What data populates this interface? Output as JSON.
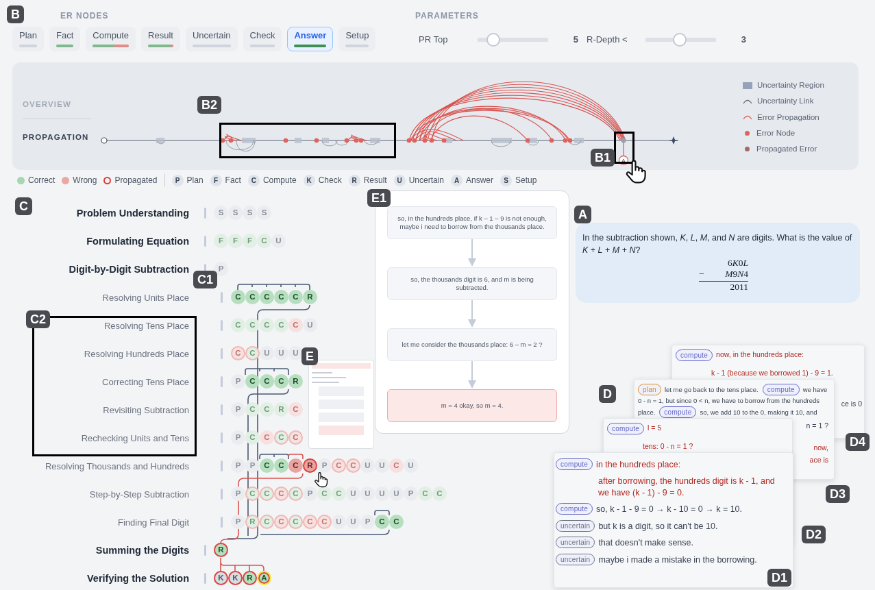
{
  "callouts": [
    "B",
    "B2",
    "B1",
    "C",
    "C1",
    "C2",
    "E",
    "E1",
    "A",
    "D",
    "D1",
    "D2",
    "D3",
    "D4"
  ],
  "filter": {
    "title": "ER NODES",
    "chips": [
      {
        "label": "Plan",
        "selected": false
      },
      {
        "label": "Fact",
        "selected": false,
        "bar": [
          {
            "kind": "correct",
            "level": 1
          }
        ]
      },
      {
        "label": "Compute",
        "selected": false,
        "bar": [
          {
            "kind": "correct",
            "level": 0.6
          },
          {
            "kind": "wrong",
            "level": 0.4
          }
        ]
      },
      {
        "label": "Result",
        "selected": false,
        "bar": [
          {
            "kind": "correct",
            "level": 0.88
          },
          {
            "kind": "wrong",
            "level": 0.12
          }
        ]
      },
      {
        "label": "Uncertain",
        "selected": false
      },
      {
        "label": "Check",
        "selected": false
      },
      {
        "label": "Answer",
        "selected": true,
        "bar": [
          {
            "kind": "correct",
            "level": 1
          }
        ]
      },
      {
        "label": "Setup",
        "selected": false
      }
    ]
  },
  "parameters": {
    "title": "PARAMETERS",
    "sliders": [
      {
        "label": "PR Top",
        "level": 0.22,
        "value": "5"
      },
      {
        "label": "R-Depth <",
        "level": 0.49,
        "value": "3"
      }
    ]
  },
  "overview": {
    "tabs": [
      {
        "label": "OVERVIEW",
        "selected": false
      },
      {
        "label": "PROPAGATION",
        "selected": true
      }
    ],
    "answer_marker": "A",
    "legend": [
      {
        "kind": "region",
        "label": "Uncertainty Region"
      },
      {
        "kind": "uncertain-link",
        "label": "Uncertainty Link"
      },
      {
        "kind": "error-link",
        "label": "Error Propagation"
      },
      {
        "kind": "error-node",
        "label": "Error Node"
      },
      {
        "kind": "propagated-node",
        "label": "Propagated Error"
      }
    ]
  },
  "legend": {
    "statuses": [
      {
        "kind": "correct",
        "label": "Correct"
      },
      {
        "kind": "wrong",
        "label": "Wrong"
      },
      {
        "kind": "propagated",
        "label": "Propagated"
      }
    ],
    "types": [
      {
        "letter": "P",
        "label": "Plan"
      },
      {
        "letter": "F",
        "label": "Fact"
      },
      {
        "letter": "C",
        "label": "Compute"
      },
      {
        "letter": "K",
        "label": "Check"
      },
      {
        "letter": "R",
        "label": "Result"
      },
      {
        "letter": "U",
        "label": "Uncertain"
      },
      {
        "letter": "A",
        "label": "Answer"
      },
      {
        "letter": "S",
        "label": "Setup"
      }
    ]
  },
  "tree": [
    {
      "label": "Problem Understanding",
      "kind": "phase",
      "nodes": [
        {
          "letter": "S",
          "kind": "neutral",
          "active": false,
          "propagated": false
        },
        {
          "letter": "S",
          "kind": "neutral",
          "active": false,
          "propagated": false
        },
        {
          "letter": "S",
          "kind": "neutral",
          "active": false,
          "propagated": false
        },
        {
          "letter": "S",
          "kind": "neutral",
          "active": false,
          "propagated": false
        }
      ]
    },
    {
      "label": "Formulating Equation",
      "kind": "phase",
      "nodes": [
        {
          "letter": "F",
          "kind": "correct",
          "active": false,
          "propagated": false
        },
        {
          "letter": "F",
          "kind": "correct",
          "active": false,
          "propagated": false
        },
        {
          "letter": "F",
          "kind": "correct",
          "active": false,
          "propagated": false
        },
        {
          "letter": "C",
          "kind": "correct",
          "active": false,
          "propagated": false
        },
        {
          "letter": "U",
          "kind": "neutral",
          "active": false,
          "propagated": false
        }
      ]
    },
    {
      "label": "Digit-by-Digit Subtraction",
      "kind": "phase",
      "nodes": [
        {
          "letter": "P",
          "kind": "neutral",
          "active": false,
          "propagated": false
        }
      ]
    },
    {
      "label": "Resolving Units Place",
      "kind": "step",
      "nodes": [
        {
          "letter": "C",
          "kind": "correct",
          "active": true,
          "propagated": false
        },
        {
          "letter": "C",
          "kind": "correct",
          "active": true,
          "propagated": false
        },
        {
          "letter": "C",
          "kind": "correct",
          "active": true,
          "propagated": false
        },
        {
          "letter": "C",
          "kind": "correct",
          "active": true,
          "propagated": false
        },
        {
          "letter": "C",
          "kind": "correct",
          "active": true,
          "propagated": false
        },
        {
          "letter": "R",
          "kind": "correct",
          "active": true,
          "propagated": false
        }
      ]
    },
    {
      "label": "Resolving Tens Place",
      "kind": "step",
      "nodes": [
        {
          "letter": "C",
          "kind": "correct",
          "active": false,
          "propagated": false
        },
        {
          "letter": "C",
          "kind": "correct",
          "active": false,
          "propagated": false
        },
        {
          "letter": "C",
          "kind": "correct",
          "active": false,
          "propagated": false
        },
        {
          "letter": "C",
          "kind": "correct",
          "active": false,
          "propagated": false
        },
        {
          "letter": "C",
          "kind": "wrong",
          "active": false,
          "propagated": false
        },
        {
          "letter": "U",
          "kind": "neutral",
          "active": false,
          "propagated": false
        }
      ]
    },
    {
      "label": "Resolving Hundreds Place",
      "kind": "step",
      "nodes": [
        {
          "letter": "C",
          "kind": "wrong",
          "active": false,
          "propagated": true
        },
        {
          "letter": "C",
          "kind": "correct",
          "active": false,
          "propagated": true
        },
        {
          "letter": "U",
          "kind": "neutral",
          "active": false,
          "propagated": false
        },
        {
          "letter": "U",
          "kind": "neutral",
          "active": false,
          "propagated": false
        },
        {
          "letter": "U",
          "kind": "neutral",
          "active": false,
          "propagated": false
        }
      ]
    },
    {
      "label": "Correcting Tens Place",
      "kind": "step",
      "nodes": [
        {
          "letter": "P",
          "kind": "neutral",
          "active": false,
          "propagated": false
        },
        {
          "letter": "C",
          "kind": "correct",
          "active": true,
          "propagated": false
        },
        {
          "letter": "C",
          "kind": "correct",
          "active": true,
          "propagated": false
        },
        {
          "letter": "C",
          "kind": "correct",
          "active": true,
          "propagated": false
        },
        {
          "letter": "R",
          "kind": "correct",
          "active": true,
          "propagated": false
        }
      ]
    },
    {
      "label": "Revisiting Subtraction",
      "kind": "step",
      "nodes": [
        {
          "letter": "P",
          "kind": "neutral",
          "active": false,
          "propagated": false
        },
        {
          "letter": "C",
          "kind": "correct",
          "active": false,
          "propagated": false
        },
        {
          "letter": "C",
          "kind": "correct",
          "active": false,
          "propagated": false
        },
        {
          "letter": "R",
          "kind": "correct",
          "active": false,
          "propagated": false
        },
        {
          "letter": "C",
          "kind": "wrong",
          "active": false,
          "propagated": false
        }
      ]
    },
    {
      "label": "Rechecking Units and Tens",
      "kind": "step",
      "nodes": [
        {
          "letter": "P",
          "kind": "neutral",
          "active": false,
          "propagated": false
        },
        {
          "letter": "C",
          "kind": "correct",
          "active": false,
          "propagated": false
        },
        {
          "letter": "C",
          "kind": "wrong",
          "active": false,
          "propagated": false
        },
        {
          "letter": "C",
          "kind": "correct",
          "active": false,
          "propagated": true
        },
        {
          "letter": "C",
          "kind": "wrong",
          "active": false,
          "propagated": true
        }
      ]
    },
    {
      "label": "Resolving Thousands and Hundreds",
      "kind": "step",
      "nodes": [
        {
          "letter": "P",
          "kind": "neutral",
          "active": false,
          "propagated": false
        },
        {
          "letter": "P",
          "kind": "neutral",
          "active": false,
          "propagated": false
        },
        {
          "letter": "C",
          "kind": "correct",
          "active": true,
          "propagated": false
        },
        {
          "letter": "C",
          "kind": "correct",
          "active": true,
          "propagated": false
        },
        {
          "letter": "C",
          "kind": "wrong",
          "active": true,
          "propagated": false
        },
        {
          "letter": "R",
          "kind": "wrong",
          "active": true,
          "propagated": true
        },
        {
          "letter": "P",
          "kind": "neutral",
          "active": false,
          "propagated": false
        },
        {
          "letter": "C",
          "kind": "wrong",
          "active": false,
          "propagated": true
        },
        {
          "letter": "C",
          "kind": "wrong",
          "active": false,
          "propagated": true
        },
        {
          "letter": "U",
          "kind": "neutral",
          "active": false,
          "propagated": false
        },
        {
          "letter": "U",
          "kind": "neutral",
          "active": false,
          "propagated": false
        },
        {
          "letter": "C",
          "kind": "wrong",
          "active": false,
          "propagated": false
        },
        {
          "letter": "U",
          "kind": "neutral",
          "active": false,
          "propagated": false
        }
      ]
    },
    {
      "label": "Step-by-Step Subtraction",
      "kind": "step",
      "nodes": [
        {
          "letter": "P",
          "kind": "neutral",
          "active": false,
          "propagated": false
        },
        {
          "letter": "C",
          "kind": "correct",
          "active": false,
          "propagated": true
        },
        {
          "letter": "C",
          "kind": "correct",
          "active": false,
          "propagated": true
        },
        {
          "letter": "C",
          "kind": "wrong",
          "active": false,
          "propagated": true
        },
        {
          "letter": "C",
          "kind": "correct",
          "active": false,
          "propagated": true
        },
        {
          "letter": "P",
          "kind": "neutral",
          "active": false,
          "propagated": false
        },
        {
          "letter": "C",
          "kind": "correct",
          "active": false,
          "propagated": false
        },
        {
          "letter": "C",
          "kind": "correct",
          "active": false,
          "propagated": false
        },
        {
          "letter": "U",
          "kind": "neutral",
          "active": false,
          "propagated": false
        },
        {
          "letter": "U",
          "kind": "neutral",
          "active": false,
          "propagated": false
        },
        {
          "letter": "U",
          "kind": "neutral",
          "active": false,
          "propagated": false
        },
        {
          "letter": "U",
          "kind": "neutral",
          "active": false,
          "propagated": false
        },
        {
          "letter": "P",
          "kind": "neutral",
          "active": false,
          "propagated": false
        },
        {
          "letter": "C",
          "kind": "correct",
          "active": false,
          "propagated": false
        },
        {
          "letter": "C",
          "kind": "correct",
          "active": false,
          "propagated": false
        }
      ]
    },
    {
      "label": "Finding Final Digit",
      "kind": "step",
      "nodes": [
        {
          "letter": "P",
          "kind": "neutral",
          "active": false,
          "propagated": false
        },
        {
          "letter": "R",
          "kind": "correct",
          "active": false,
          "propagated": true
        },
        {
          "letter": "C",
          "kind": "correct",
          "active": false,
          "propagated": true
        },
        {
          "letter": "C",
          "kind": "wrong",
          "active": false,
          "propagated": true
        },
        {
          "letter": "C",
          "kind": "correct",
          "active": false,
          "propagated": true
        },
        {
          "letter": "C",
          "kind": "wrong",
          "active": false,
          "propagated": true
        },
        {
          "letter": "C",
          "kind": "wrong",
          "active": false,
          "propagated": true
        },
        {
          "letter": "U",
          "kind": "neutral",
          "active": false,
          "propagated": false
        },
        {
          "letter": "U",
          "kind": "neutral",
          "active": false,
          "propagated": false
        },
        {
          "letter": "P",
          "kind": "neutral",
          "active": false,
          "propagated": false
        },
        {
          "letter": "C",
          "kind": "correct",
          "active": true,
          "propagated": false
        },
        {
          "letter": "C",
          "kind": "correct",
          "active": true,
          "propagated": false
        }
      ]
    },
    {
      "label": "Summing the Digits",
      "kind": "phase",
      "nodes": [
        {
          "letter": "R",
          "kind": "correct",
          "active": true,
          "propagated": true
        }
      ]
    },
    {
      "label": "Verifying the Solution",
      "kind": "phase",
      "nodes": [
        {
          "letter": "K",
          "kind": "neutral",
          "active": true,
          "propagated": true,
          "highlighted": false
        },
        {
          "letter": "K",
          "kind": "neutral",
          "active": true,
          "propagated": true,
          "highlighted": false
        },
        {
          "letter": "R",
          "kind": "correct",
          "active": true,
          "propagated": true,
          "highlighted": false
        },
        {
          "letter": "A",
          "kind": "correct",
          "active": true,
          "propagated": true,
          "highlighted": true
        }
      ]
    }
  ],
  "graph": {
    "steps": [
      {
        "text": "so, in the hundreds place, if k – 1 – 9 is not enough, maybe i need to borrow from the thousands place.",
        "error": false
      },
      {
        "text": "so, the thousands digit is 6, and m is being subtracted.",
        "error": false
      },
      {
        "text": "let me consider the thousands place: 6 – m = 2 ?",
        "error": false
      },
      {
        "text": "m = 4 okay, so m = 4.",
        "error": true
      }
    ]
  },
  "problem": {
    "text": "In the subtraction shown, *K*, *L*, *M*, and *N* are digits. What is the value of *K* + *L* + *M* + *N*?",
    "rows": [
      {
        "op": "",
        "parts": [
          {
            "text": "6",
            "italic": false
          },
          {
            "text": "K",
            "italic": true
          },
          {
            "text": "0",
            "italic": false
          },
          {
            "text": "L",
            "italic": true
          }
        ]
      },
      {
        "op": "−",
        "parts": [
          {
            "text": "M",
            "italic": true
          },
          {
            "text": "9",
            "italic": false
          },
          {
            "text": "N",
            "italic": true
          },
          {
            "text": "4",
            "italic": false
          }
        ]
      },
      {
        "op": "",
        "parts": [
          {
            "text": "2011",
            "italic": false
          }
        ]
      }
    ]
  },
  "cards": [
    {
      "blocks": [
        {
          "kind": "tagged",
          "tag": {
            "label": "compute",
            "color": "#6366c9"
          },
          "text": "now, in the hundreds place:",
          "wrong": true
        },
        {
          "kind": "indent",
          "text": "k - 1 (because we borrowed 1) - 9 = 1.",
          "wrong": true
        },
        {
          "kind": "fragment",
          "text": "ce is 0",
          "wrong": false
        }
      ]
    },
    {
      "blocks": [
        {
          "kind": "flow",
          "parts": [
            {
              "tag": {
                "label": "plan",
                "color": "#e08a1e"
              }
            },
            {
              "text": "let me go back to the tens place."
            },
            {
              "tag": {
                "label": "compute",
                "color": "#6366c9"
              }
            },
            {
              "text": "we have 0 - n = 1, but since 0 < n, we have to borrow from the hundreds place."
            },
            {
              "tag": {
                "label": "compute",
                "color": "#6366c9"
              }
            },
            {
              "text": "so, we add 10 to the 0, making it 10, and"
            }
          ]
        },
        {
          "kind": "fragment",
          "text": "n = 1 ?",
          "wrong": false
        },
        {
          "kind": "fragment",
          "text": "now,",
          "wrong": true
        },
        {
          "kind": "fragment",
          "text": "ace is",
          "wrong": true
        }
      ]
    },
    {
      "blocks": [
        {
          "kind": "tagged",
          "tag": {
            "label": "compute",
            "color": "#6366c9"
          },
          "text": "l = 5",
          "wrong": true
        },
        {
          "kind": "indent",
          "text": "tens: 0 - n = 1 ?",
          "wrong": true
        }
      ]
    },
    {
      "blocks": [
        {
          "kind": "tagged",
          "tag": {
            "label": "compute",
            "color": "#6366c9"
          },
          "text": "in the hundreds place:",
          "wrong": true
        },
        {
          "kind": "indent",
          "text": "after borrowing, the hundreds digit is k - 1, and we have (k - 1) - 9 = 0.",
          "wrong": true
        },
        {
          "kind": "tagged",
          "tag": {
            "label": "compute",
            "color": "#6366c9"
          },
          "text": "so, k - 1 - 9 = 0 → k - 10 = 0 → k = 10.",
          "wrong": false
        },
        {
          "kind": "tagged",
          "tag": {
            "label": "uncertain",
            "color": "#6b7280"
          },
          "text": "but k is a digit, so it can't be 10.",
          "wrong": false
        },
        {
          "kind": "tagged",
          "tag": {
            "label": "uncertain",
            "color": "#6b7280"
          },
          "text": "that doesn't make sense.",
          "wrong": false
        },
        {
          "kind": "tagged",
          "tag": {
            "label": "uncertain",
            "color": "#6b7280"
          },
          "text": "maybe i made a mistake in the borrowing.",
          "wrong": false
        }
      ]
    }
  ]
}
